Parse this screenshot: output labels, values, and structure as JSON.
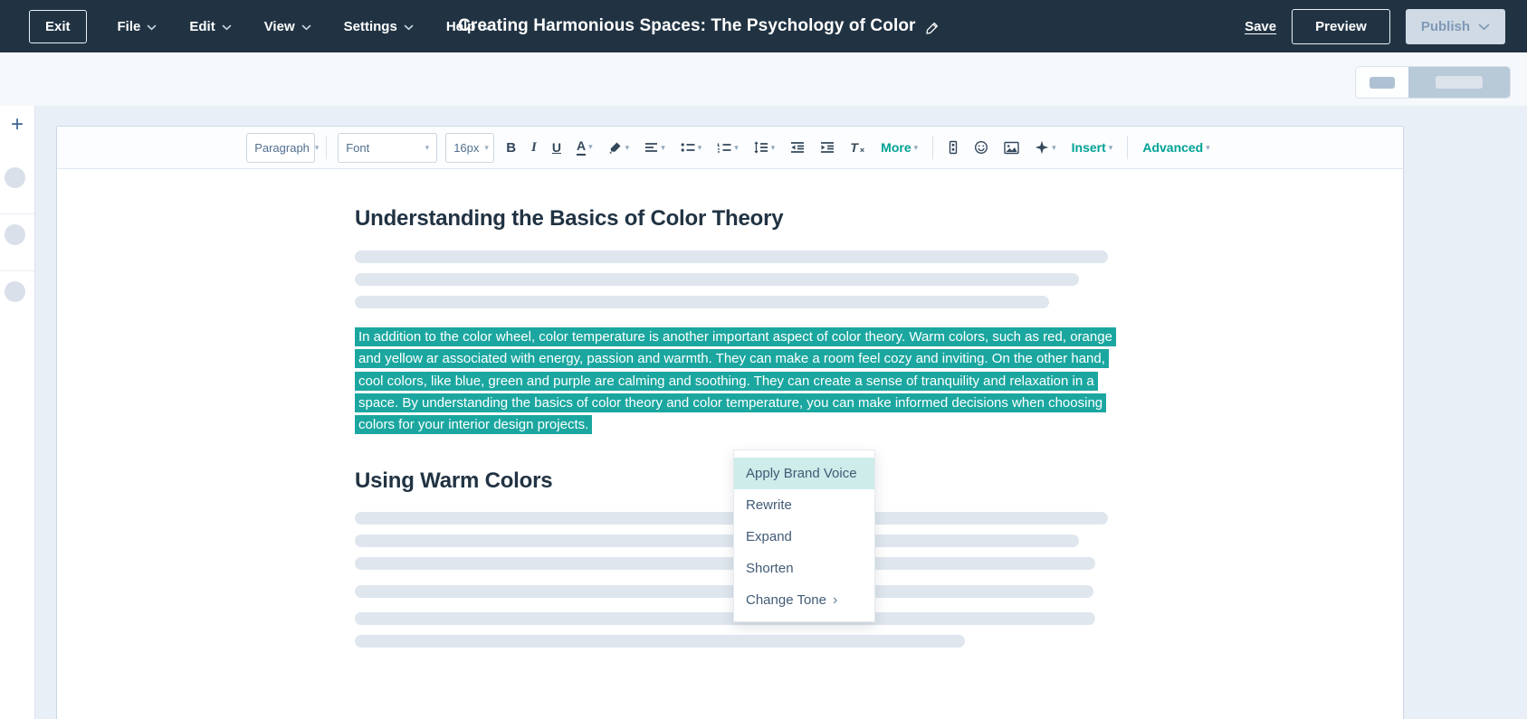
{
  "navbar": {
    "exit": "Exit",
    "menus": [
      "File",
      "Edit",
      "View",
      "Settings",
      "Help"
    ],
    "title": "Creating Harmonious Spaces: The Psychology of Color",
    "save": "Save",
    "preview": "Preview",
    "publish": "Publish"
  },
  "toolbar": {
    "paragraph": "Paragraph",
    "font": "Font",
    "size": "16px",
    "more": "More",
    "insert": "Insert",
    "advanced": "Advanced"
  },
  "document": {
    "heading_1": "Understanding the Basics of Color Theory",
    "highlighted_paragraph": "In addition to the color wheel, color temperature is another important aspect of color theory. Warm colors, such as red, orange and yellow ar associated with energy, passion and warmth. They can make a room feel cozy and inviting. On the other hand, cool colors, like blue, green and purple are calming and soothing. They can create a sense of tranquility and relaxation in a space. By understanding the basics of color theory and color temperature, you can make informed decisions when choosing colors for your interior design projects.",
    "heading_2": "Using Warm Colors"
  },
  "context_menu": {
    "selected": "Apply Brand Voice",
    "items": [
      {
        "label": "Apply Brand Voice"
      },
      {
        "label": "Rewrite"
      },
      {
        "label": "Expand"
      },
      {
        "label": "Shorten"
      },
      {
        "label": "Change Tone"
      }
    ]
  },
  "icons": {
    "plus": "+",
    "caret": "▾",
    "bold": "B",
    "italic": "I",
    "underline": "U",
    "font_color": "A",
    "clear_t": "T",
    "clear_x": "×",
    "submenu": "›"
  },
  "colors": {
    "navbar_bg": "#213343",
    "accent_teal": "#00a295",
    "highlight_teal": "#1ba7a0",
    "menu_selected_bg": "#cdecea",
    "publish_disabled_bg": "#d0dae4",
    "skeleton_bar": "#dfe6ee"
  }
}
